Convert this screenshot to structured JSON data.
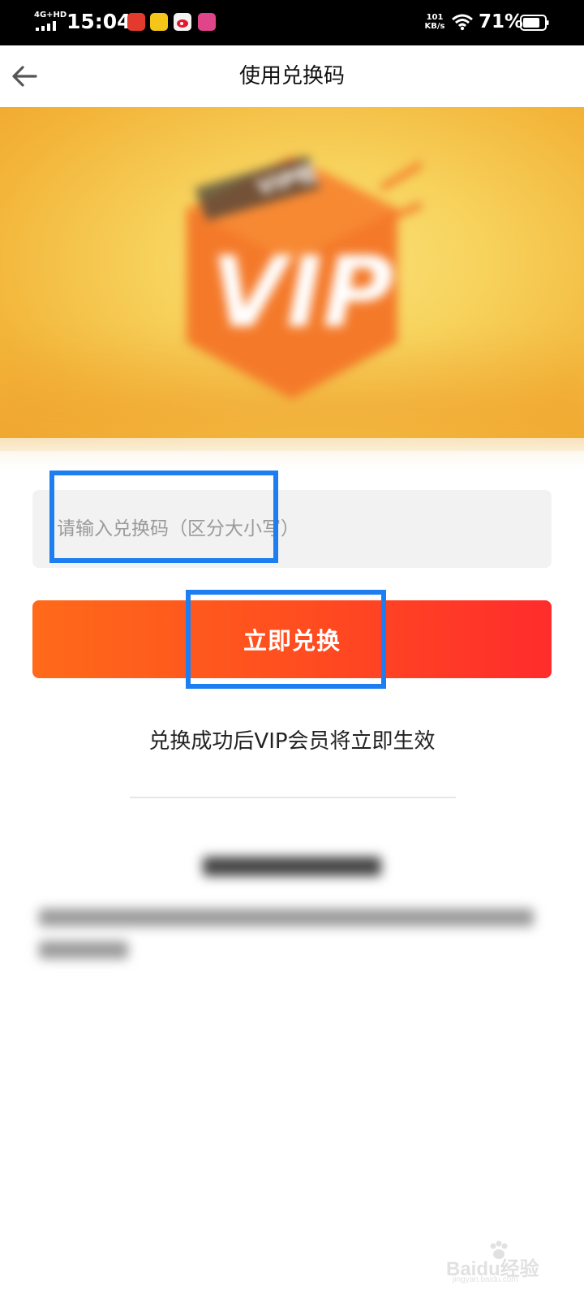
{
  "status_bar": {
    "network": "4G+HD",
    "time": "15:04",
    "speed_value": "101",
    "speed_unit": "KB/s",
    "battery_percent": "71%",
    "app_icons": [
      "news-app-icon",
      "emoji-app-icon",
      "weibo-icon",
      "shop-app-icon"
    ]
  },
  "nav": {
    "back_icon": "arrow-left-icon",
    "title": "使用兑换码"
  },
  "banner": {
    "art_text": "VIP",
    "ribbon_text": "VIP啦"
  },
  "redeem": {
    "input_placeholder": "请输入兑换码（区分大小写）",
    "input_value": "",
    "button_label": "立即兑换",
    "info_text": "兑换成功后VIP会员将立即生效"
  },
  "watermark": {
    "text": "Baidu经验",
    "sub": "jingyan.baidu.com"
  },
  "colors": {
    "accent_start": "#ff6a1a",
    "accent_end": "#ff2c2c",
    "highlight": "#1c7ef0",
    "banner_bg": "#f7d35d"
  }
}
